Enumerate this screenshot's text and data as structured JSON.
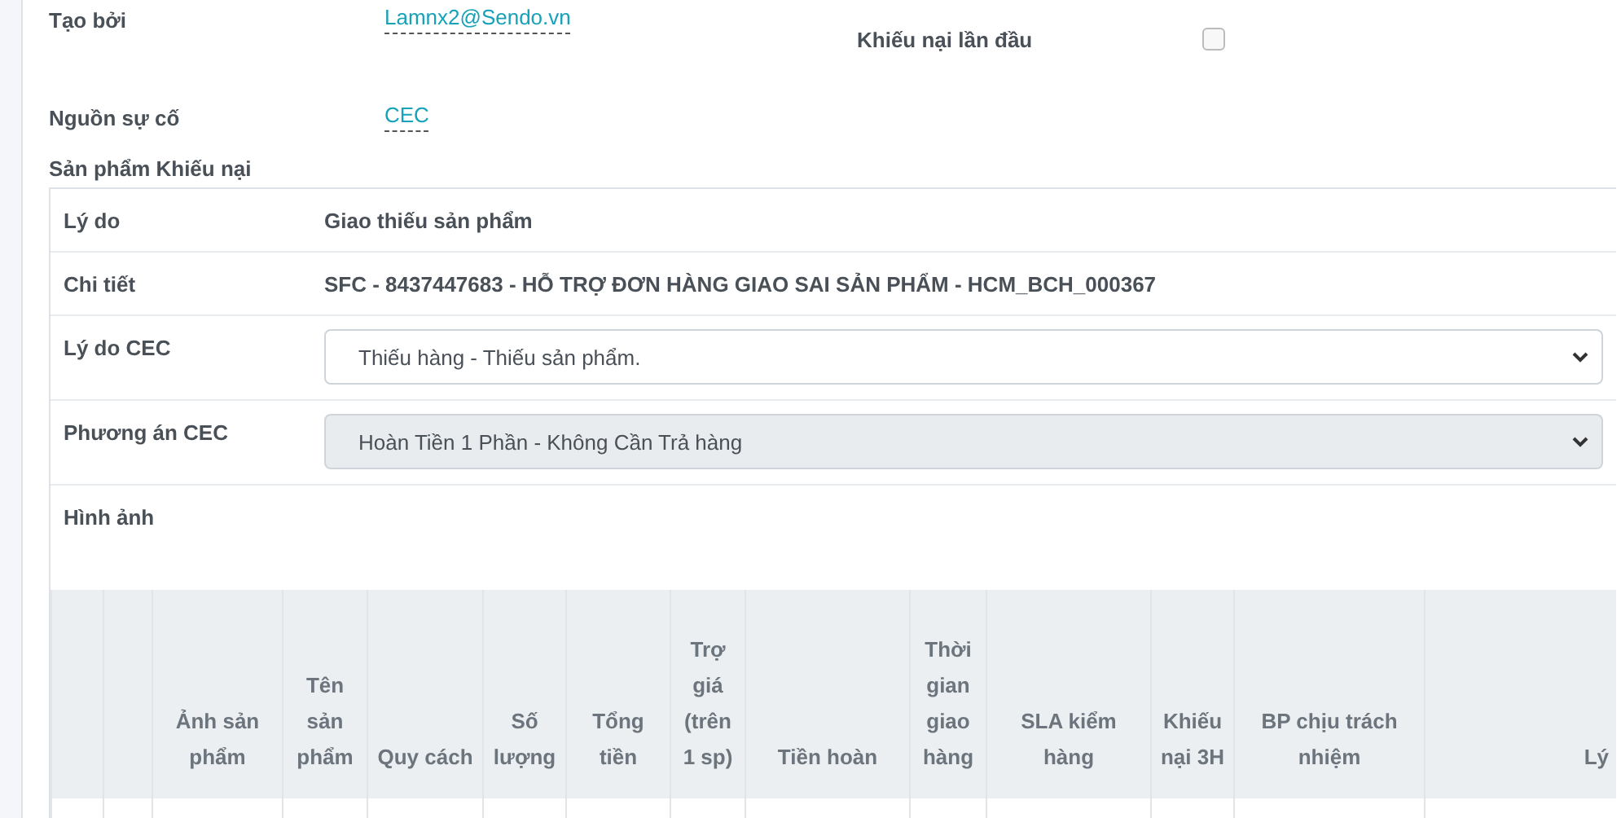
{
  "fields_left": [
    {
      "label": "Tạo bởi",
      "value": "Lamnx2@Sendo.vn"
    },
    {
      "label": "Nguồn sự cố",
      "value": "CEC"
    }
  ],
  "first_complaint": {
    "label": "Khiếu nại lần đầu",
    "checked": false
  },
  "section_title": "Sản phẩm Khiếu nại",
  "details": [
    {
      "kind": "text",
      "label": "Lý do",
      "value": "Giao thiếu sản phẩm"
    },
    {
      "kind": "text",
      "label": "Chi tiết",
      "value": "SFC - 8437447683 - HỖ TRỢ ĐƠN HÀNG GIAO SAI SẢN PHẨM - HCM_BCH_000367"
    },
    {
      "kind": "select",
      "label": "Lý do CEC",
      "value": "Thiếu hàng - Thiếu sản phẩm.",
      "disabled": false
    },
    {
      "kind": "select",
      "label": "Phương án CEC",
      "value": "Hoàn Tiền 1 Phần - Không Cần Trả hàng",
      "disabled": true
    },
    {
      "kind": "images",
      "label": "Hình ảnh"
    }
  ],
  "table": {
    "columns": [
      "",
      "",
      "Ảnh sản phẩm",
      "Tên sản phẩm",
      "Quy cách",
      "Số lượng",
      "Tổng tiền",
      "Trợ giá (trên 1 sp)",
      "Tiền hoàn",
      "Thời gian giao hàng",
      "SLA kiểm hàng",
      "Khiếu nại 3H",
      "BP chịu trách nhiệm",
      "Lý"
    ]
  }
}
